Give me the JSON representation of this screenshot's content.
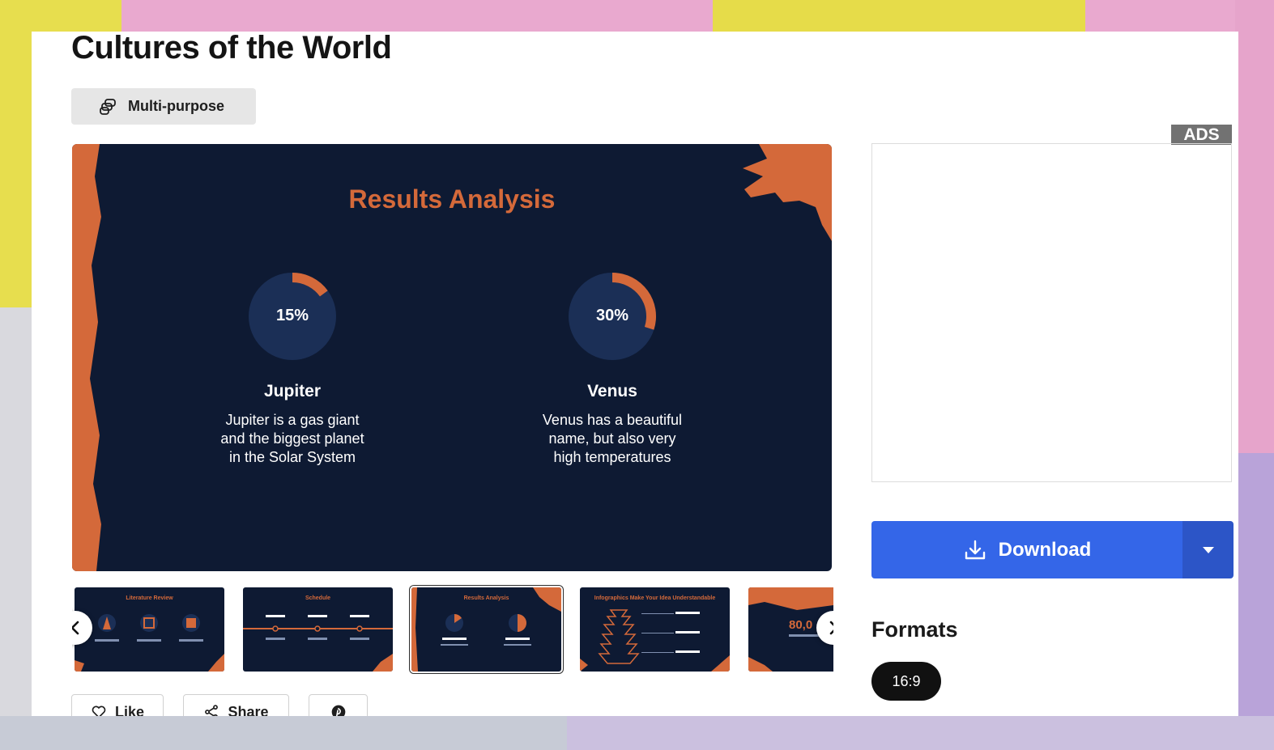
{
  "page": {
    "title": "Cultures of the World",
    "tag": {
      "label": "Multi-purpose",
      "icon": "multi-purpose-icon"
    }
  },
  "slide": {
    "title": "Results Analysis",
    "colors": {
      "background": "#0e1a33",
      "accent": "#d4693a",
      "ring": "#1b2f56"
    },
    "items": [
      {
        "percent_label": "15%",
        "percent": 15,
        "name": "Jupiter",
        "desc_lines": [
          "Jupiter is a gas giant",
          "and the biggest planet",
          "in the Solar System"
        ]
      },
      {
        "percent_label": "30%",
        "percent": 30,
        "name": "Venus",
        "desc_lines": [
          "Venus has a beautiful",
          "name, but also very",
          "high temperatures"
        ]
      }
    ]
  },
  "thumbnails": [
    {
      "title": "Literature Review",
      "active": false
    },
    {
      "title": "Schedule",
      "active": false
    },
    {
      "title": "Results Analysis",
      "active": true
    },
    {
      "title": "Infographics Make Your Idea Understandable",
      "active": false
    },
    {
      "title": "80,0",
      "active": false
    }
  ],
  "actions": {
    "like": "Like",
    "share": "Share"
  },
  "sidebar": {
    "ads_label": "ADS",
    "download_label": "Download",
    "download_color": "#3466e8",
    "formats_title": "Formats",
    "formats": [
      "16:9"
    ]
  }
}
